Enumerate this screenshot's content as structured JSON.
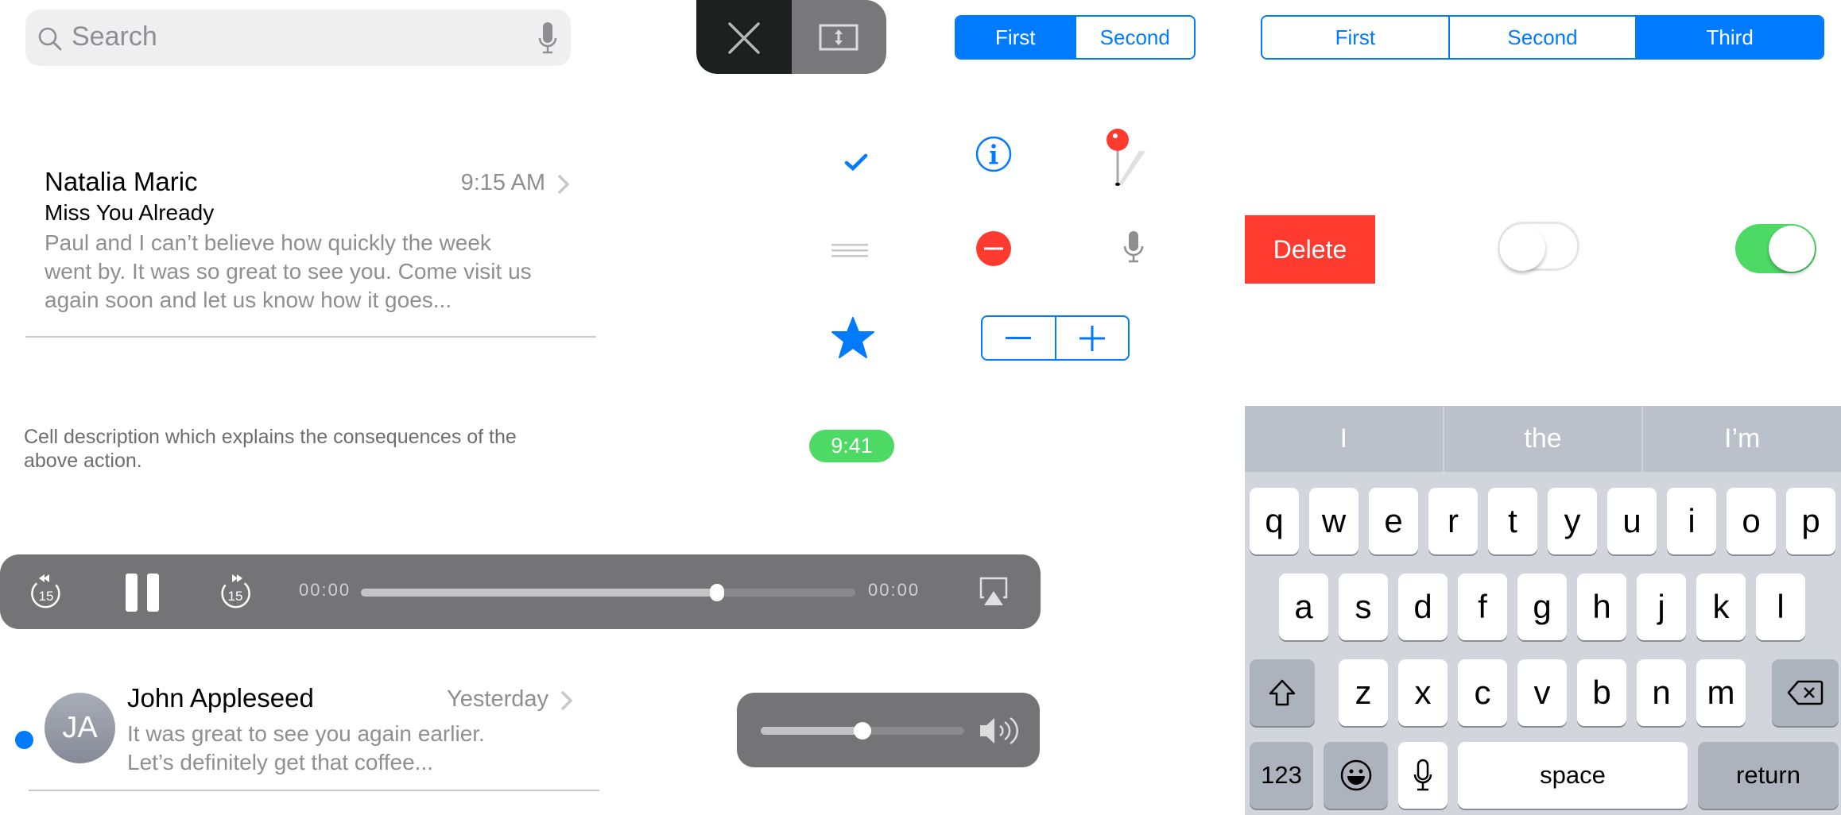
{
  "search": {
    "placeholder": "Search",
    "icon": "search-icon",
    "mic_icon": "microphone-icon"
  },
  "mail_cell": {
    "sender": "Natalia Maric",
    "time": "9:15 AM",
    "subject": "Miss You Already",
    "preview_lines": [
      "Paul and I can’t believe how quickly the week",
      "went by. It was so great to see you. Come visit us",
      "again soon and let us know how it goes..."
    ]
  },
  "cell_description": {
    "lines": [
      "Cell description which explains the consequences of the",
      "above action."
    ]
  },
  "media_controls": {
    "skip_back_label": "15",
    "skip_forward_label": "15",
    "elapsed": "00:00",
    "remaining": "00:00",
    "progress": 0.72,
    "state": "playing",
    "airplay_icon": "airplay-icon"
  },
  "message_cell": {
    "unread": true,
    "avatar_initials": "JA",
    "sender": "John Appleseed",
    "time": "Yesterday",
    "preview_lines": [
      "It was great to see you again earlier.",
      "Let’s definitely get that coffee..."
    ]
  },
  "video_controls": {
    "close_icon": "close-icon",
    "resize_icon": "aspect-fill-icon"
  },
  "segmented_two": {
    "segments": [
      "First",
      "Second"
    ],
    "selected": 0
  },
  "segmented_three": {
    "segments": [
      "First",
      "Second",
      "Third"
    ],
    "selected": 2
  },
  "icons": [
    "checkmark-icon",
    "info-icon",
    "map-pin-icon",
    "reorder-icon",
    "delete-circle-icon",
    "microphone-icon",
    "star-icon"
  ],
  "stepper": {
    "minus": "−",
    "plus": "+"
  },
  "badge": {
    "time": "9:41"
  },
  "delete_button": {
    "label": "Delete"
  },
  "toggles": {
    "first_on": false,
    "second_on": true
  },
  "volume": {
    "level": 0.5,
    "icon": "speaker-icon"
  },
  "keyboard": {
    "suggestions": [
      "I",
      "the",
      "I’m"
    ],
    "row1": [
      "q",
      "w",
      "e",
      "r",
      "t",
      "y",
      "u",
      "i",
      "o",
      "p"
    ],
    "row2": [
      "a",
      "s",
      "d",
      "f",
      "g",
      "h",
      "j",
      "k",
      "l"
    ],
    "row3": [
      "z",
      "x",
      "c",
      "v",
      "b",
      "n",
      "m"
    ],
    "numbers_label": "123",
    "space_label": "space",
    "return_label": "return"
  },
  "colors": {
    "accent": "#007aff",
    "destructive": "#ff3b30",
    "success": "#4cd964",
    "secondary_text": "#8e8e93"
  }
}
